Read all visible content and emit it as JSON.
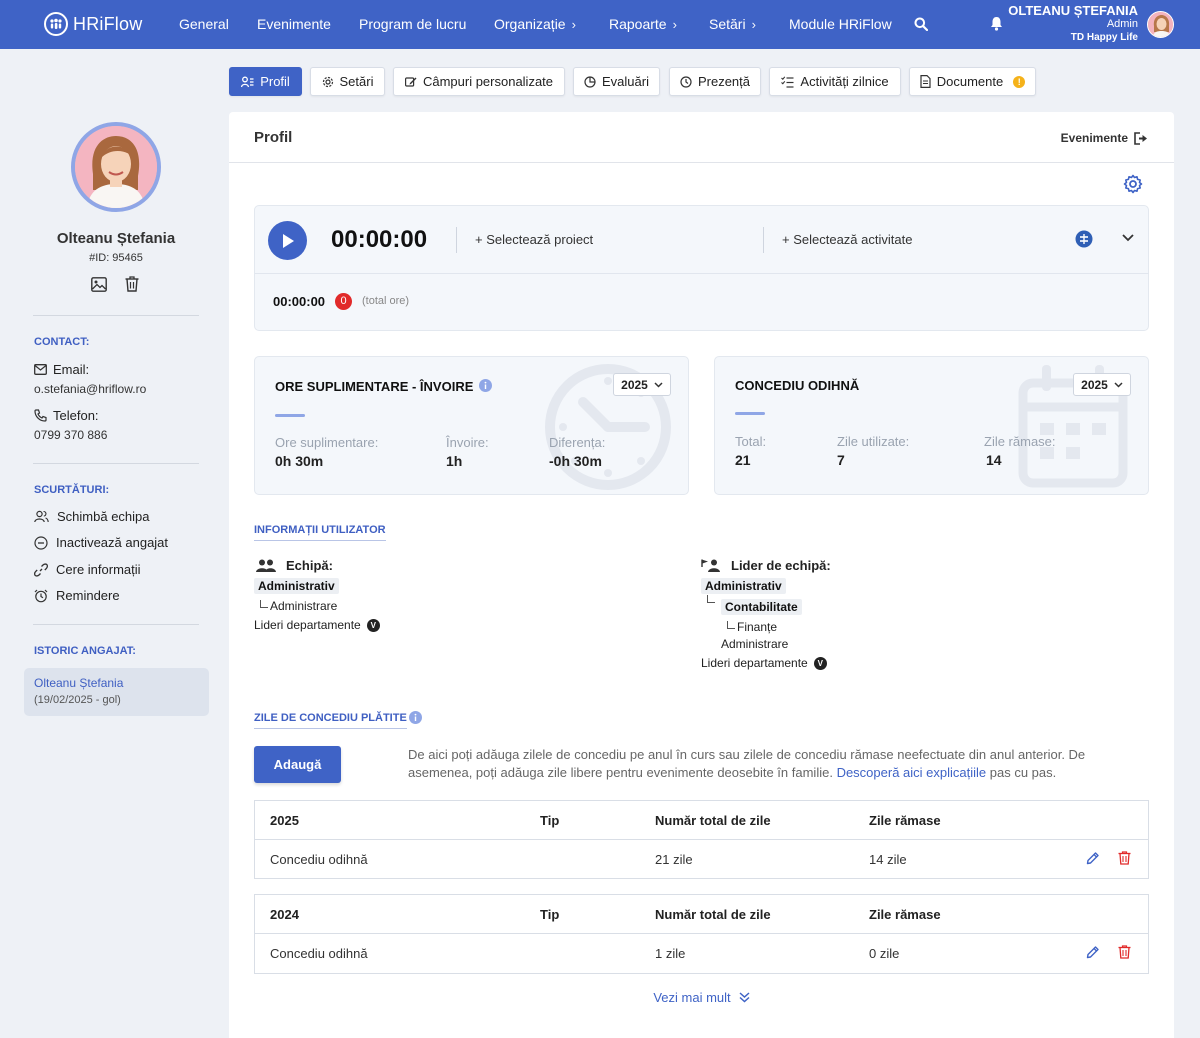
{
  "app": {
    "logo_text": "HRiFlow",
    "nav": [
      {
        "label": "General"
      },
      {
        "label": "Evenimente"
      },
      {
        "label": "Program de lucru"
      },
      {
        "label": "Organizație"
      },
      {
        "label": "Rapoarte"
      },
      {
        "label": "Setări"
      },
      {
        "label": "Module HRiFlow"
      }
    ],
    "user": {
      "name": "OLTEANU ȘTEFANIA",
      "role": "Admin",
      "company": "TD Happy Life"
    }
  },
  "tabs": [
    {
      "label": "Profil",
      "icon": "user-list-icon",
      "active": true
    },
    {
      "label": "Setări",
      "icon": "gear-icon"
    },
    {
      "label": "Câmpuri personalizate",
      "icon": "edit-field-icon"
    },
    {
      "label": "Evaluări",
      "icon": "pie-chart-icon"
    },
    {
      "label": "Prezență",
      "icon": "clock-icon"
    },
    {
      "label": "Activități zilnice",
      "icon": "checklist-icon"
    },
    {
      "label": "Documente",
      "icon": "document-icon",
      "alert": "!"
    }
  ],
  "sidebar": {
    "name": "Olteanu Ștefania",
    "id": "#ID: 95465",
    "contact_heading": "CONTACT:",
    "email_label": "Email:",
    "email": "o.stefania@hriflow.ro",
    "phone_label": "Telefon:",
    "phone": "0799 370 886",
    "shortcuts_heading": "SCURTĂTURI:",
    "shortcuts": [
      {
        "label": "Schimbă echipa",
        "icon": "users-icon"
      },
      {
        "label": "Inactivează angajat",
        "icon": "minus-circle-icon"
      },
      {
        "label": "Cere informații",
        "icon": "link-icon"
      },
      {
        "label": "Remindere",
        "icon": "alarm-icon"
      }
    ],
    "history_heading": "ISTORIC ANGAJAT:",
    "history": {
      "name": "Olteanu Ștefania",
      "period": "(19/02/2025 - gol)"
    }
  },
  "card": {
    "title": "Profil",
    "events_link": "Evenimente"
  },
  "timer": {
    "time": "00:00:00",
    "select_project": "+ Selectează proiect",
    "select_activity": "+ Selectează activitate",
    "total_time": "00:00:00",
    "total_count": "0",
    "total_label": "(total ore)"
  },
  "overtime": {
    "title": "ORE SUPLIMENTARE - ÎNVOIRE",
    "year": "2025",
    "stats": [
      {
        "label": "Ore suplimentare:",
        "value": "0h 30m"
      },
      {
        "label": "Învoire:",
        "value": "1h"
      },
      {
        "label": "Diferența:",
        "value": "-0h 30m"
      }
    ]
  },
  "leave": {
    "title": "CONCEDIU ODIHNĂ",
    "year": "2025",
    "stats": [
      {
        "label": "Total:",
        "value": "21"
      },
      {
        "label": "Zile utilizate:",
        "value": "7"
      },
      {
        "label": "Zile rămase:",
        "value": "14"
      }
    ]
  },
  "user_info": {
    "heading": "INFORMAȚII UTILIZATOR",
    "team_label": "Echipă:",
    "team_tag": "Administrativ",
    "team_child": "Administrare",
    "team_leaders": "Lideri departamente",
    "leader_label": "Lider de echipă:",
    "leader_tag1": "Administrativ",
    "leader_tag2": "Contabilitate",
    "leader_child1": "Finanțe",
    "leader_child2": "Administrare",
    "leader_leaders": "Lideri departamente",
    "v_badge": "V"
  },
  "paid_leave": {
    "heading": "ZILE DE CONCEDIU PLĂTITE",
    "add_button": "Adaugă",
    "desc_before": "De aici poți adăuga zilele de concediu pe anul în curs sau zilele de concediu rămase neefectuate din anul anterior. De asemenea, poți adăuga zile libere pentru evenimente deosebite în familie. ",
    "desc_link": "Descoperă aici explicațiile",
    "desc_after": " pas cu pas.",
    "col_type": "Tip",
    "col_total": "Număr total de zile",
    "col_remaining": "Zile rămase",
    "tables": [
      {
        "year": "2025",
        "name": "Concediu odihnă",
        "total": "21 zile",
        "remaining": "14 zile"
      },
      {
        "year": "2024",
        "name": "Concediu odihnă",
        "total": "1 zile",
        "remaining": "0 zile"
      }
    ],
    "more": "Vezi mai mult"
  },
  "colors": {
    "primary": "#3f63c6",
    "danger": "#e12a2a",
    "accent_light": "#8fa6e6"
  }
}
